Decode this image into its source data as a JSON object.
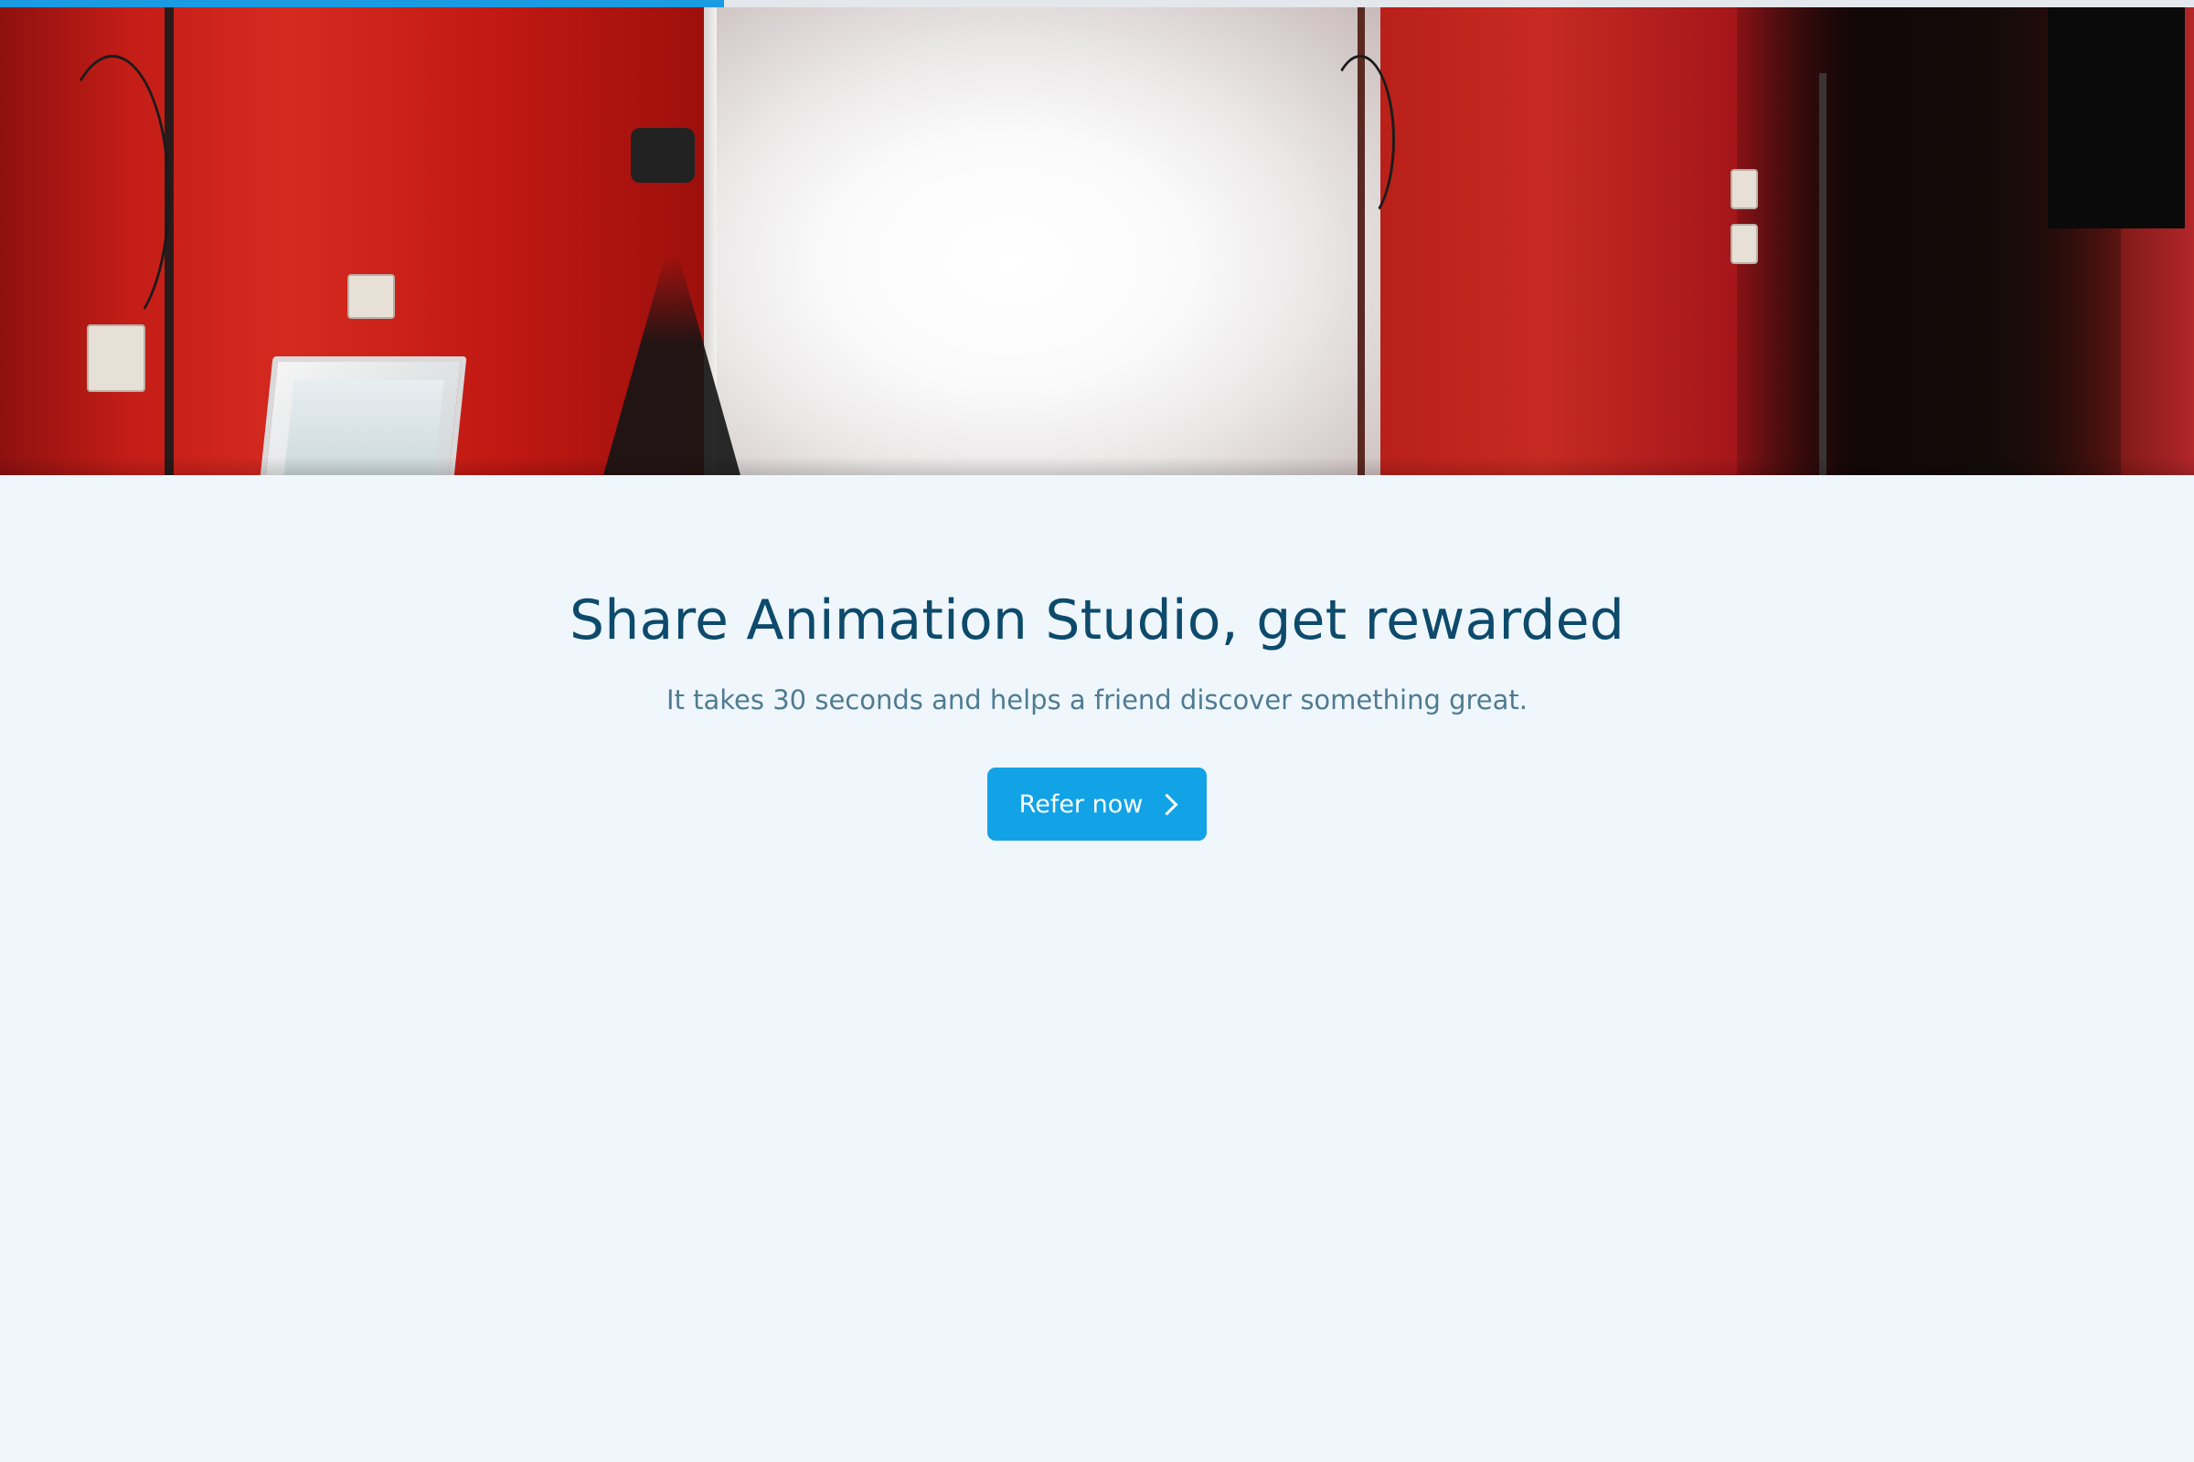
{
  "progress": {
    "fraction": 0.33,
    "fill_color": "#1a9be2",
    "track_color": "#e4e7ec"
  },
  "hero": {
    "image_description_icon": "studio-photo"
  },
  "headline": "Share Animation Studio, get rewarded",
  "subline": "It takes 30 seconds and helps a friend discover something great.",
  "cta": {
    "label": "Refer now",
    "icon": "chevron-right-icon",
    "color": "#12a2e6"
  },
  "colors": {
    "background": "#eff7fd",
    "headline": "#0d4a6b",
    "subline": "#4f7b92"
  }
}
